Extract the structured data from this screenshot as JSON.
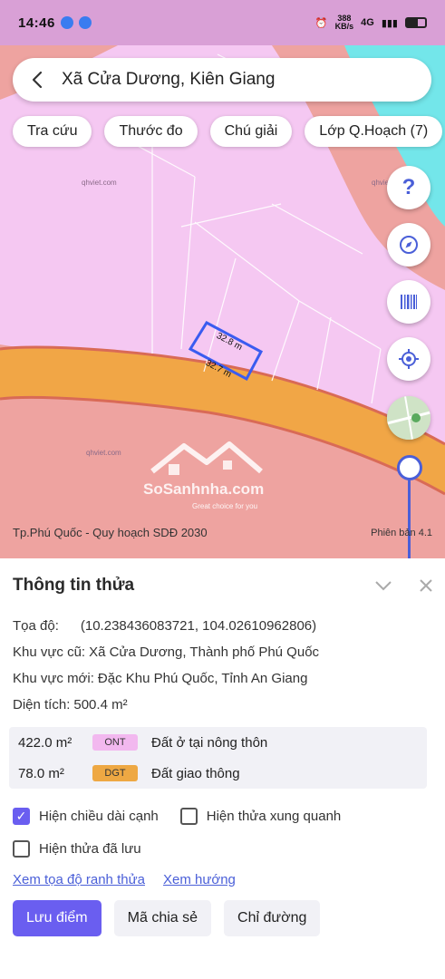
{
  "status_bar": {
    "time": "14:46",
    "network_speed_value": "388",
    "network_speed_unit": "KB/s",
    "network_type": "4G"
  },
  "search": {
    "location": "Xã Cửa Dương, Kiên Giang"
  },
  "chips": [
    {
      "label": "Tra cứu"
    },
    {
      "label": "Thước đo"
    },
    {
      "label": "Chú giải"
    },
    {
      "label": "Lớp Q.Hoạch (7)"
    }
  ],
  "map": {
    "watermark_site": "qhviet.com",
    "parcel_edge_top": "32.8 m",
    "parcel_edge_bottom": "32.7 m",
    "plan_name": "Tp.Phú Quốc - Quy hoạch SDĐ 2030",
    "version": "Phiên bản 4.1",
    "brand_name": "SoSanhnha.com",
    "brand_tagline": "Great choice for you",
    "fab_help": "?",
    "colors": {
      "residential": "#f5c8f2",
      "agricultural": "#eea3a0",
      "road": "#f1a646",
      "water": "#73e6ea",
      "accent": "#4a5fd8"
    }
  },
  "panel": {
    "title": "Thông tin thửa",
    "coords_label": "Tọa độ:",
    "coords_value": "(10.238436083721, 104.02610962806)",
    "old_area_label": "Khu vực cũ:",
    "old_area_value": "Xã Cửa Dương, Thành phố Phú Quốc",
    "new_area_label": "Khu vực mới:",
    "new_area_value": "Đặc Khu Phú Quốc, Tỉnh An Giang",
    "size_label": "Diện tích:",
    "size_value": "500.4 m²",
    "usage": [
      {
        "area": "422.0 m²",
        "code": "ONT",
        "desc": "Đất ở tại nông thôn"
      },
      {
        "area": "78.0 m²",
        "code": "DGT",
        "desc": "Đất giao thông"
      }
    ],
    "options": {
      "show_edge_length": "Hiện chiều dài cạnh",
      "show_nearby": "Hiện thửa xung quanh",
      "show_saved": "Hiện thửa đã lưu"
    },
    "links": {
      "view_coords": "Xem tọa độ ranh thửa",
      "view_direction": "Xem hướng"
    },
    "buttons": {
      "save_point": "Lưu điểm",
      "share_code": "Mã chia sẻ",
      "directions": "Chỉ đường"
    }
  }
}
